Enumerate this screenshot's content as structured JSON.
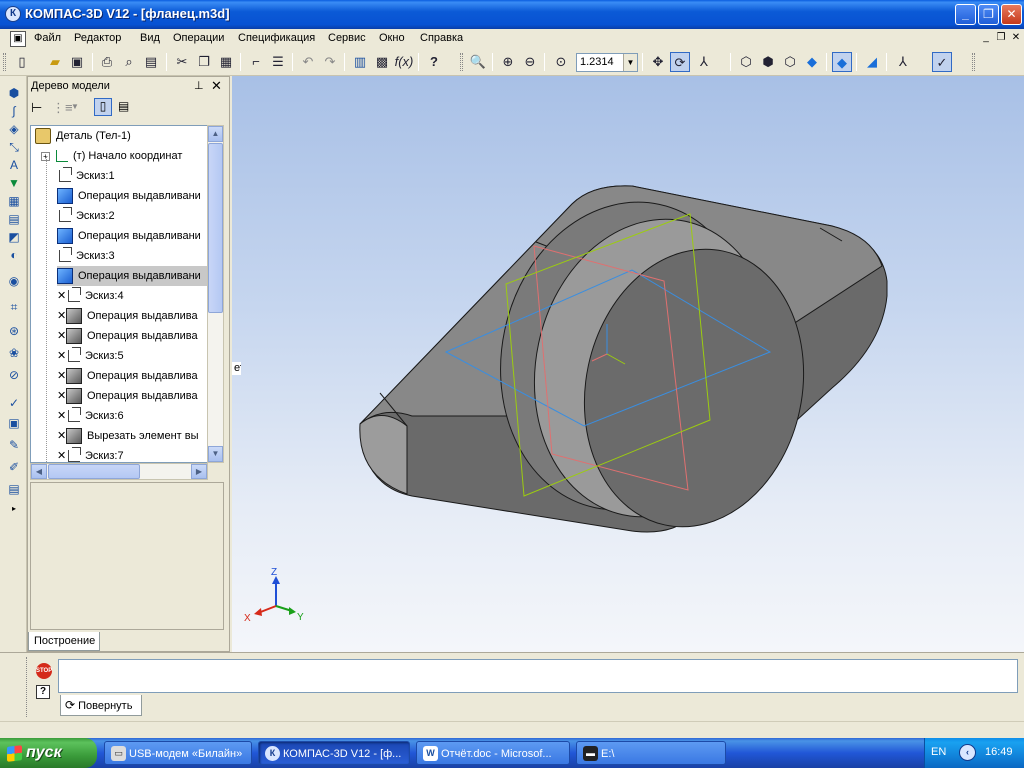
{
  "window": {
    "title": "КОМПАС-3D V12 - [фланец.m3d]",
    "app_icon": "kompas-logo-icon",
    "controls": {
      "minimize": "_",
      "maximize": "❐",
      "close": "✕"
    }
  },
  "menu": {
    "items": [
      "Файл",
      "Редактор",
      "Вид",
      "Операции",
      "Спецификация",
      "Сервис",
      "Окно",
      "Справка"
    ],
    "mdi_controls": {
      "minimize": "_",
      "restore": "❐",
      "close": "✕"
    }
  },
  "toolbar": {
    "zoom_value": "1.2314",
    "icons": [
      "new-doc-icon",
      "open-icon",
      "save-icon",
      "print-icon",
      "print-preview-icon",
      "sheet-icon",
      "cut-icon",
      "copy-icon",
      "paste-icon",
      "format-brush-icon",
      "properties-icon",
      "undo-icon",
      "redo-icon",
      "manager-icon",
      "library-icon",
      "variables-icon",
      "help-pointer-icon",
      "zoom-window-icon",
      "zoom-in-icon",
      "zoom-out-icon",
      "zoom-scale-icon",
      "pan-icon",
      "rotate-icon",
      "orientation-icon",
      "wireframe-icon",
      "hidden-lines-icon",
      "thin-lines-icon",
      "halftone-icon",
      "halftone-edges-icon",
      "perspective-icon",
      "filter-icon",
      "snap-icon"
    ]
  },
  "tree": {
    "title": "Дерево модели",
    "nodes": [
      {
        "label": "Деталь (Тел-1)",
        "icon": "part-icon",
        "excluded": false,
        "expander": false
      },
      {
        "label": "(т) Начало координат",
        "icon": "origin-icon",
        "excluded": false,
        "expander": true
      },
      {
        "label": "Эскиз:1",
        "icon": "sketch-icon",
        "excluded": false
      },
      {
        "label": "Операция выдавливани",
        "icon": "extrude-icon",
        "excluded": false
      },
      {
        "label": "Эскиз:2",
        "icon": "sketch-icon",
        "excluded": false
      },
      {
        "label": "Операция выдавливани",
        "icon": "extrude-icon",
        "excluded": false
      },
      {
        "label": "Эскиз:3",
        "icon": "sketch-icon",
        "excluded": false
      },
      {
        "label": "Операция выдавливани",
        "icon": "extrude-icon",
        "excluded": false,
        "selected": true
      },
      {
        "label": "Эскиз:4",
        "icon": "sketch-icon",
        "excluded": true
      },
      {
        "label": "Операция выдавлива",
        "icon": "extrude-gray-icon",
        "excluded": true
      },
      {
        "label": "Операция выдавлива",
        "icon": "extrude-gray-icon",
        "excluded": true
      },
      {
        "label": "Эскиз:5",
        "icon": "sketch-icon",
        "excluded": true
      },
      {
        "label": "Операция выдавлива",
        "icon": "extrude-gray-icon",
        "excluded": true
      },
      {
        "label": "Операция выдавлива",
        "icon": "extrude-gray-icon",
        "excluded": true
      },
      {
        "label": "Эскиз:6",
        "icon": "sketch-icon",
        "excluded": true
      },
      {
        "label": "Вырезать элемент вы",
        "icon": "cut-extrude-gray-icon",
        "excluded": true
      },
      {
        "label": "Эскиз:7",
        "icon": "sketch-icon",
        "excluded": true
      }
    ],
    "tab_label": "Построение"
  },
  "viewport": {
    "stray_text": "ет",
    "axes": {
      "z": "Z",
      "x": "X",
      "y": "Y"
    },
    "colors": {
      "body": "#6b6b6b",
      "plane_zx": "#e07070",
      "plane_yz": "#9ccc10",
      "plane_xy": "#3a8ee0"
    }
  },
  "bottom": {
    "stop_label": "STOP",
    "help_label": "?",
    "property_tab_label": "Повернуть"
  },
  "taskbar": {
    "start_label": "пуск",
    "tasks": [
      {
        "label": "USB-модем «Билайн»",
        "icon": "modem-icon",
        "active": false
      },
      {
        "label": "КОМПАС-3D V12 - [ф...",
        "icon": "kompas-icon",
        "active": true
      },
      {
        "label": "Отчёт.doc - Microsof...",
        "icon": "word-icon",
        "active": false
      },
      {
        "label": "E:\\",
        "icon": "console-icon",
        "active": false
      }
    ],
    "language": "EN",
    "clock": "16:49"
  }
}
